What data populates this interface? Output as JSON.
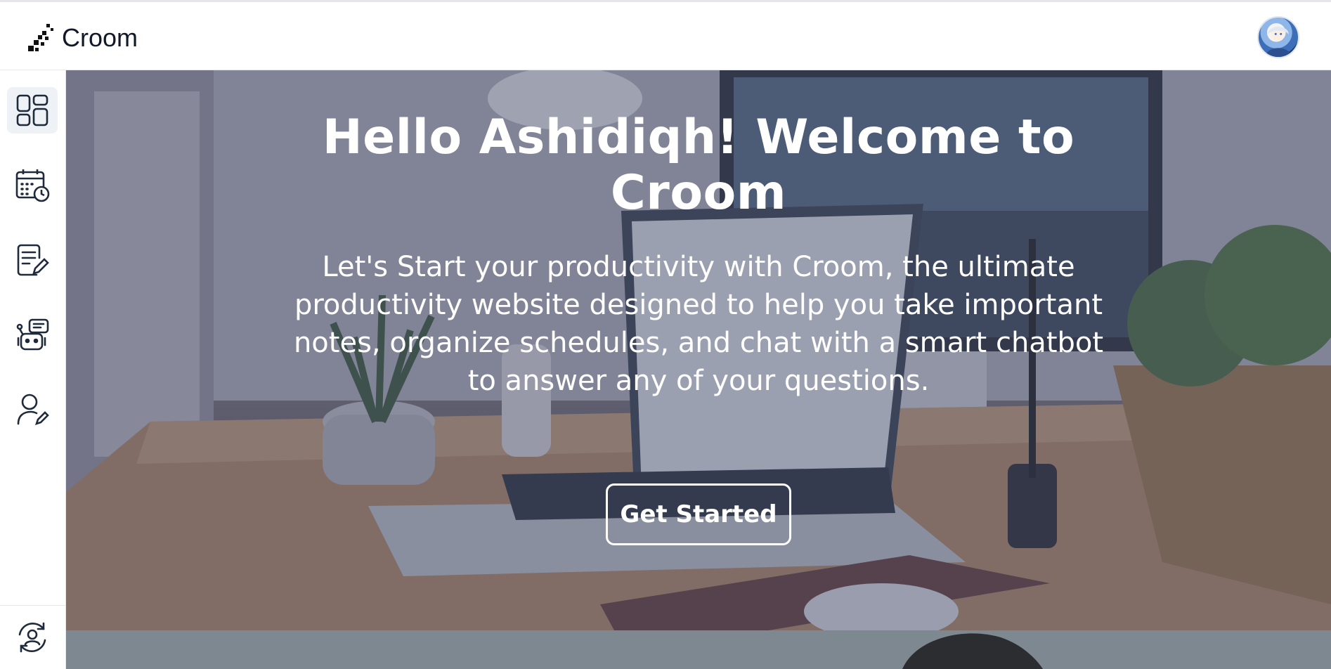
{
  "header": {
    "brand_name": "Croom",
    "logo_icon": "croom-logo-icon",
    "avatar_icon": "user-avatar"
  },
  "sidebar": {
    "items": [
      {
        "id": "dashboard",
        "icon": "dashboard-grid-icon",
        "active": true
      },
      {
        "id": "schedule",
        "icon": "calendar-clock-icon",
        "active": false
      },
      {
        "id": "notes",
        "icon": "note-edit-icon",
        "active": false
      },
      {
        "id": "chatbot",
        "icon": "robot-chat-icon",
        "active": false
      },
      {
        "id": "profile",
        "icon": "user-edit-icon",
        "active": false
      }
    ],
    "bottom_item": {
      "id": "switch-account",
      "icon": "user-sync-icon"
    }
  },
  "hero": {
    "title": "Hello Ashidiqh! Welcome to Croom",
    "description": "Let's Start your productivity with Croom, the ultimate productivity website designed to help you take important notes, organize schedules, and chat with a smart chatbot to answer any of your questions.",
    "cta_label": "Get Started"
  },
  "colors": {
    "primary_text": "#111827",
    "icon_stroke": "#1f2a3a",
    "active_bg": "#eef2f7",
    "hero_overlay": "#464e6c"
  }
}
